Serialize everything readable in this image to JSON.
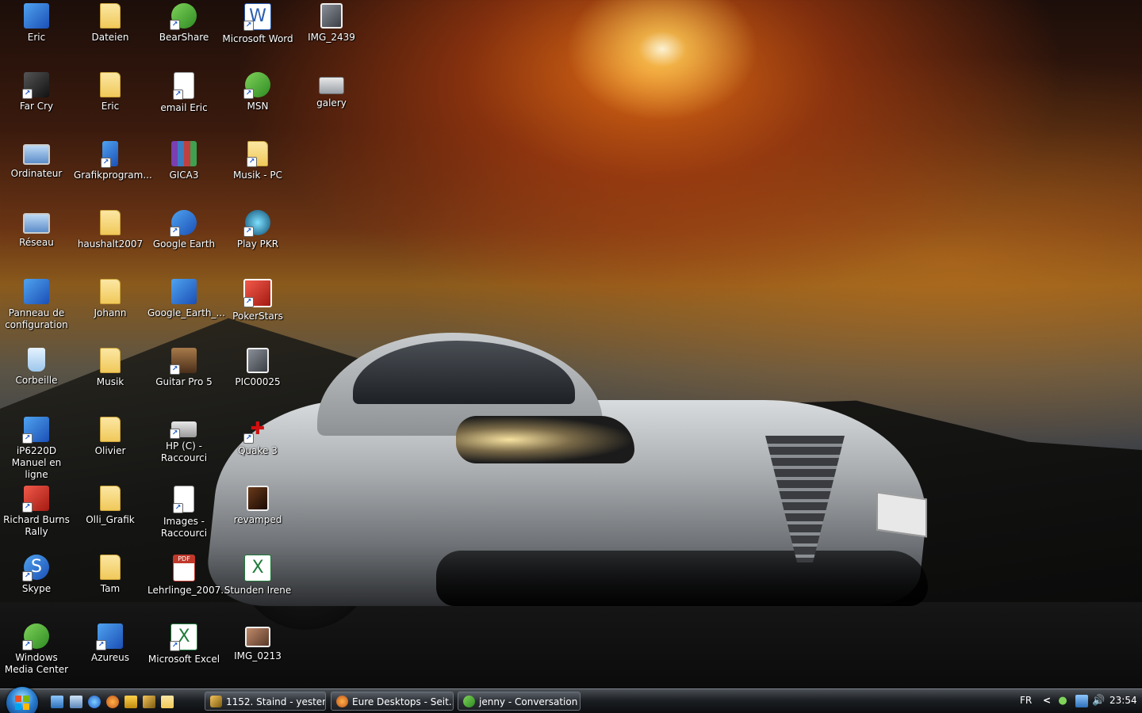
{
  "desktop": {
    "wallpaper": "car-wallpaper",
    "icons": [
      {
        "label": "Eric",
        "icon": "user-folder-icon"
      },
      {
        "label": "Far Cry",
        "icon": "far-cry-icon"
      },
      {
        "label": "Ordinateur",
        "icon": "computer-icon"
      },
      {
        "label": "Réseau",
        "icon": "network-icon"
      },
      {
        "label": "Panneau de configuration",
        "icon": "control-panel-icon"
      },
      {
        "label": "Corbeille",
        "icon": "recycle-bin-icon"
      },
      {
        "label": "iP6220D Manuel en ligne",
        "icon": "printer-manual-icon"
      },
      {
        "label": "Richard Burns Rally",
        "icon": "game-icon"
      },
      {
        "label": "Skype",
        "icon": "skype-icon"
      },
      {
        "label": "Windows Media Center",
        "icon": "media-center-icon"
      },
      {
        "label": "Dateien",
        "icon": "folder-icon"
      },
      {
        "label": "Eric",
        "icon": "folder-icon"
      },
      {
        "label": "Grafikprogram...",
        "icon": "program-icon"
      },
      {
        "label": "haushalt2007",
        "icon": "folder-icon"
      },
      {
        "label": "Johann",
        "icon": "folder-icon"
      },
      {
        "label": "Musik",
        "icon": "folder-icon"
      },
      {
        "label": "Olivier",
        "icon": "folder-icon"
      },
      {
        "label": "Olli_Grafik",
        "icon": "folder-icon"
      },
      {
        "label": "Tam",
        "icon": "folder-icon"
      },
      {
        "label": "Azureus",
        "icon": "azureus-icon"
      },
      {
        "label": "BearShare",
        "icon": "bearshare-icon"
      },
      {
        "label": "email Eric",
        "icon": "email-icon"
      },
      {
        "label": "GICA3",
        "icon": "winrar-icon"
      },
      {
        "label": "Google Earth",
        "icon": "google-earth-icon"
      },
      {
        "label": "Google_Earth_...",
        "icon": "google-earth-file-icon"
      },
      {
        "label": "Guitar Pro 5",
        "icon": "guitar-pro-icon"
      },
      {
        "label": "HP (C) - Raccourci",
        "icon": "drive-icon"
      },
      {
        "label": "Images - Raccourci",
        "icon": "images-icon"
      },
      {
        "label": "Lehrlinge_2007...",
        "icon": "pdf-icon"
      },
      {
        "label": "Microsoft Excel",
        "icon": "excel-icon"
      },
      {
        "label": "Microsoft Word",
        "icon": "word-icon"
      },
      {
        "label": "MSN",
        "icon": "msn-icon"
      },
      {
        "label": "Musik - PC",
        "icon": "music-folder-icon"
      },
      {
        "label": "Play PKR",
        "icon": "pkr-icon"
      },
      {
        "label": "PokerStars",
        "icon": "pokerstars-icon"
      },
      {
        "label": "PIC00025",
        "icon": "photo-icon"
      },
      {
        "label": "Quake 3",
        "icon": "quake-icon"
      },
      {
        "label": "revamped",
        "icon": "photo-icon"
      },
      {
        "label": "Stunden Irene",
        "icon": "excel-file-icon"
      },
      {
        "label": "IMG_0213",
        "icon": "photo-icon"
      },
      {
        "label": "IMG_2439",
        "icon": "photo-icon"
      },
      {
        "label": "galery",
        "icon": "gallery-icon"
      }
    ]
  },
  "taskbar": {
    "tasks": [
      {
        "label": "1152. Staind - yester...",
        "icon": "winamp-icon"
      },
      {
        "label": "Eure Desktops - Seit...",
        "icon": "firefox-icon"
      },
      {
        "label": "jenny - Conversation",
        "icon": "msn-icon"
      }
    ],
    "tray": {
      "language": "FR",
      "chevron": "<",
      "clock": "23:54"
    }
  },
  "colors": {
    "taskbar": "#1c1f23",
    "label_text": "#ffffff",
    "folder": "#f0c95a"
  }
}
